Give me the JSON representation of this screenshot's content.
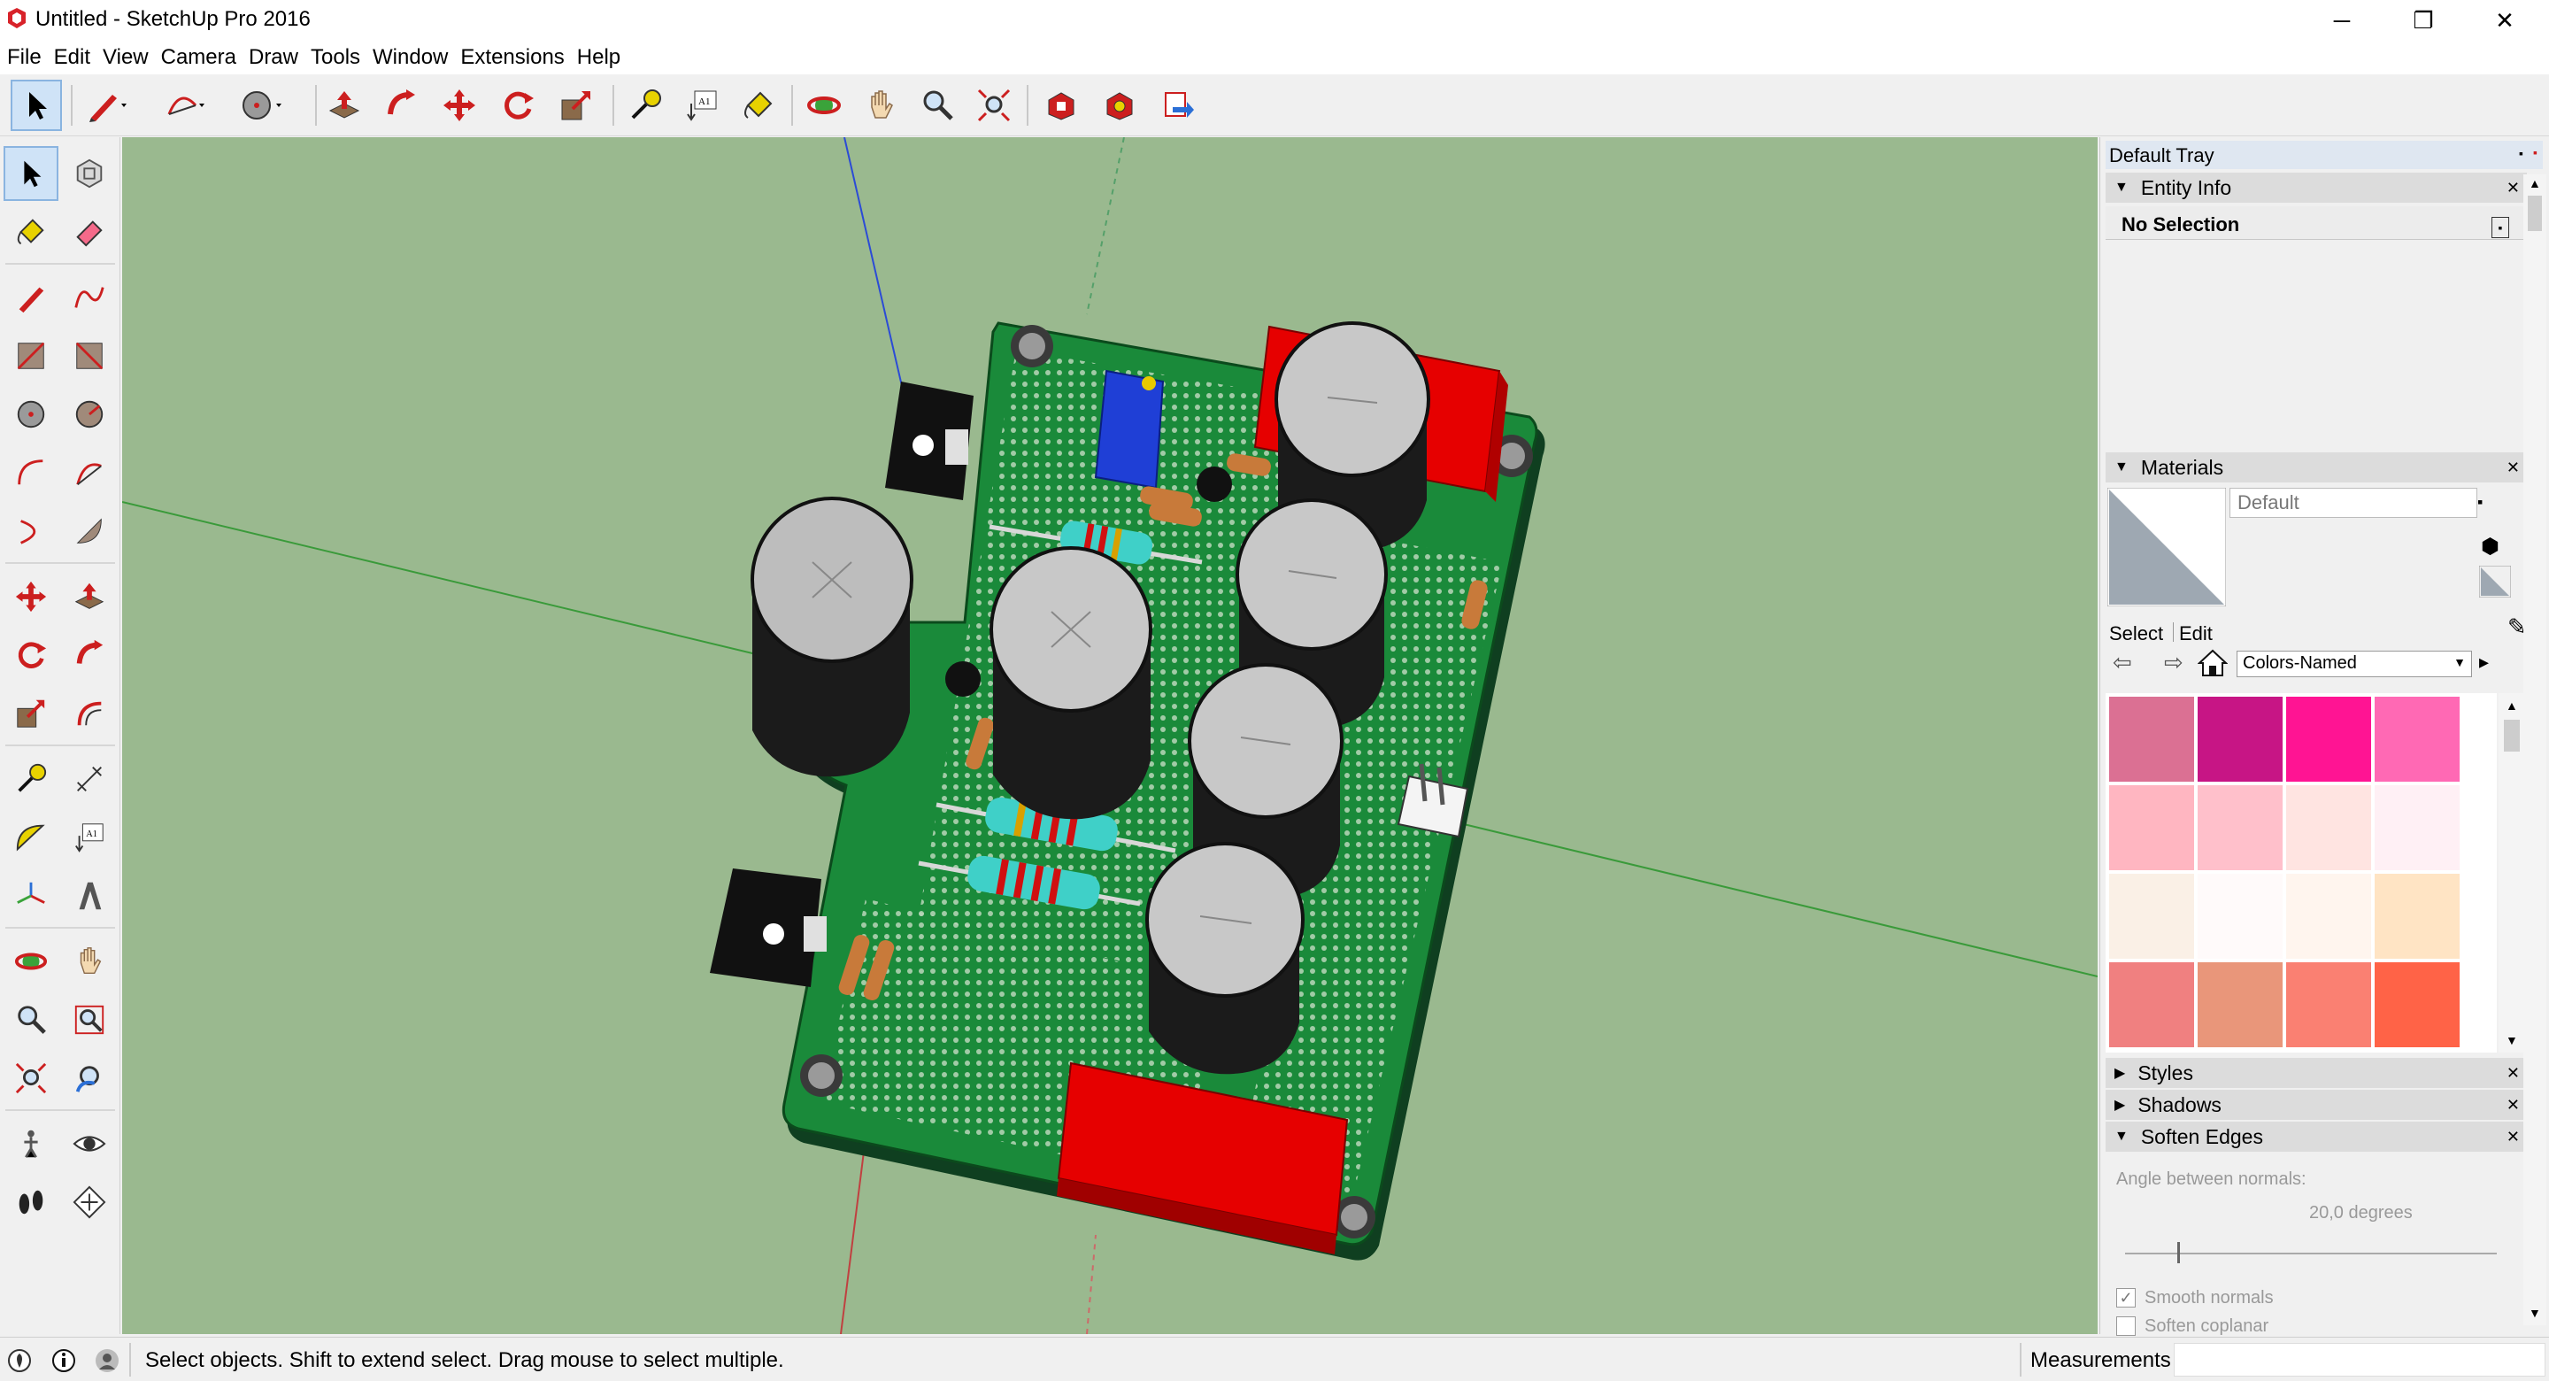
{
  "window": {
    "title": "Untitled - SketchUp Pro 2016",
    "minimize_glyph": "─",
    "restore_glyph": "❐",
    "close_glyph": "✕"
  },
  "menu": {
    "items": [
      "File",
      "Edit",
      "View",
      "Camera",
      "Draw",
      "Tools",
      "Window",
      "Extensions",
      "Help"
    ]
  },
  "toolbar": {
    "icons": [
      "select-arrow-icon",
      "pencil-line-icon",
      "arc-icon",
      "circle-icon",
      "push-pull-icon",
      "follow-me-icon",
      "move-icon",
      "rotate-icon",
      "scale-icon",
      "tape-measure-icon",
      "text-label-icon",
      "paint-bucket-icon",
      "orbit-icon",
      "pan-hand-icon",
      "zoom-icon",
      "zoom-extents-icon",
      "warehouse-icon",
      "extension-warehouse-icon",
      "layout-send-icon"
    ],
    "text_label_glyph": "A1"
  },
  "left_tools": {
    "text_label_glyph": "A1",
    "icons": [
      "select-icon",
      "make-component-icon",
      "paint-bucket-icon",
      "eraser-icon",
      "line-icon",
      "freehand-icon",
      "rectangle-icon",
      "rotated-rectangle-icon",
      "circle-icon",
      "polygon-icon",
      "arc-icon",
      "two-point-arc-icon",
      "three-point-arc-icon",
      "pie-icon",
      "move-icon",
      "push-pull-icon",
      "rotate-icon",
      "follow-me-icon",
      "scale-icon",
      "offset-icon",
      "tape-measure-icon",
      "dimension-icon",
      "protractor-icon",
      "text-icon",
      "axes-icon",
      "3d-text-icon",
      "orbit-icon",
      "pan-icon",
      "zoom-icon",
      "zoom-window-icon",
      "zoom-extents-icon",
      "previous-view-icon",
      "position-camera-icon",
      "look-around-icon",
      "walk-icon",
      "section-plane-icon"
    ]
  },
  "tray": {
    "title": "Default Tray",
    "entity_info": {
      "header": "Entity Info",
      "selection": "No Selection"
    },
    "materials": {
      "header": "Materials",
      "current_name": "Default",
      "tab_select": "Select",
      "tab_edit": "Edit",
      "library": "Colors-Named",
      "swatch_colors": [
        "#db7093",
        "#c71585",
        "#ff1493",
        "#ff69b4",
        "#ffb6c1",
        "#ffc0cb",
        "#ffe4e1",
        "#fff0f5",
        "#faf0e6",
        "#fffafa",
        "#fff5ee",
        "#ffe4c4",
        "#f08080",
        "#e9967a",
        "#fa8072",
        "#ff6347"
      ]
    },
    "styles": {
      "header": "Styles"
    },
    "shadows": {
      "header": "Shadows"
    },
    "soften_edges": {
      "header": "Soften Edges",
      "angle_label": "Angle between normals:",
      "angle_value": "20,0  degrees",
      "smooth_normals_label": "Smooth normals",
      "smooth_normals_checked": true,
      "soften_coplanar_label": "Soften coplanar",
      "soften_coplanar_checked": false,
      "slider_fraction": 0.14
    }
  },
  "status": {
    "message": "Select objects. Shift to extend select. Drag mouse to select multiple.",
    "measurements_label": "Measurements"
  },
  "colors": {
    "viewport_bg": "#9ab98f",
    "pcb_green": "#1a8a3a",
    "relay_red": "#e60000",
    "trimmer_blue": "#1f3fd6"
  }
}
